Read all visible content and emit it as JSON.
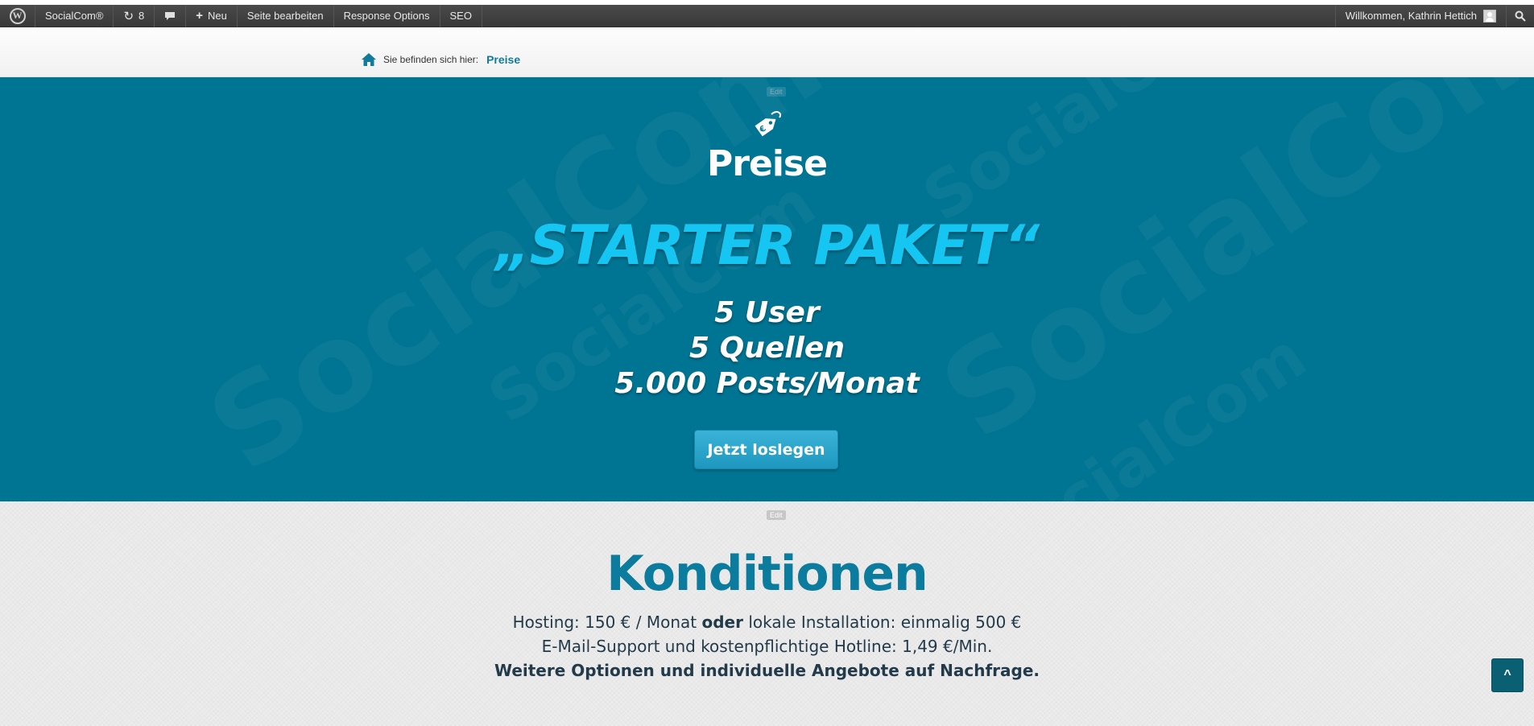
{
  "adminbar": {
    "site_name": "SocialCom®",
    "updates_count": "8",
    "new_label": "Neu",
    "edit_page_label": "Seite bearbeiten",
    "response_options_label": "Response Options",
    "seo_label": "SEO",
    "welcome_text": "Willkommen, Kathrin Hettich"
  },
  "breadcrumb": {
    "prefix": "Sie befinden sich hier:",
    "current": "Preise"
  },
  "hero": {
    "edit_label": "Edit",
    "icon": "price-tag-icon",
    "title": "Preise",
    "package": "„STARTER PAKET“",
    "features": [
      "5 User",
      "5 Quellen",
      "5.000 Posts/Monat"
    ],
    "cta_label": "Jetzt loslegen",
    "watermark_text": "SocialCom",
    "background_color": "#007593",
    "accent_color": "#15c6f3"
  },
  "konditionen": {
    "edit_label": "Edit",
    "title": "Konditionen",
    "line1_a": "Hosting: 150 € / Monat ",
    "line1_bold": "oder",
    "line1_b": " lokale Installation: einmalig 500 €",
    "line2": "E-Mail-Support und kostenpflichtige Hotline: 1,49 €/Min.",
    "line3": "Weitere Optionen und individuelle Angebote auf Nachfrage.",
    "title_color": "#0b7c9e"
  },
  "scroll_top": {
    "label": "^"
  }
}
